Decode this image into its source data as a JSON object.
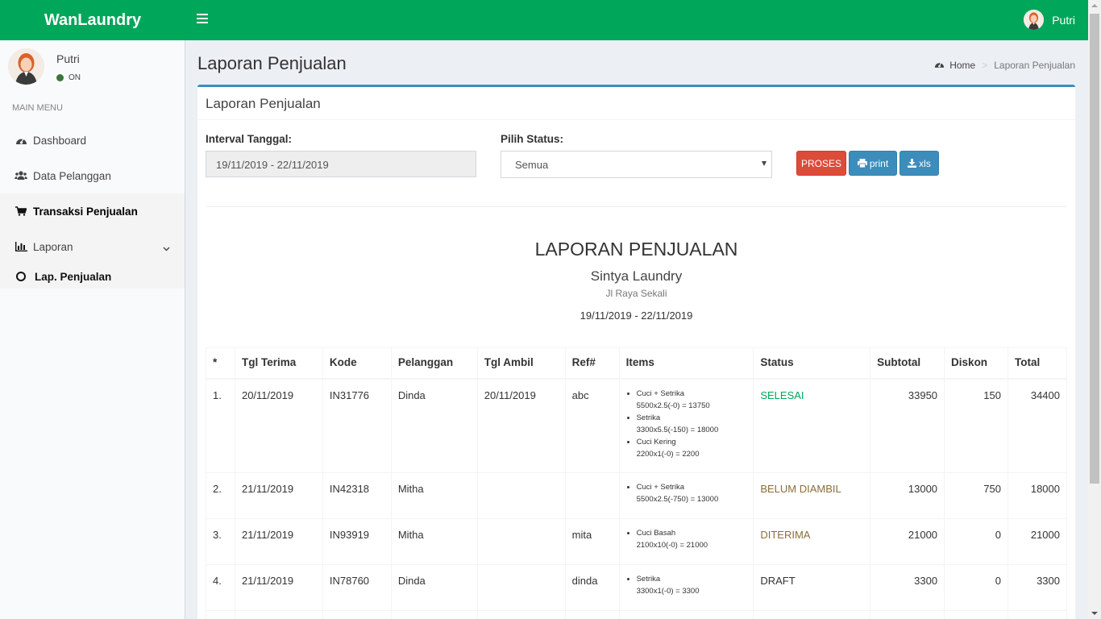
{
  "header": {
    "brand": "WanLaundry",
    "user_name": "Putri"
  },
  "sidebar": {
    "user_name": "Putri",
    "status": "ON",
    "menu_header": "MAIN MENU",
    "items": [
      {
        "label": "Dashboard",
        "icon": "dashboard-icon"
      },
      {
        "label": "Data Pelanggan",
        "icon": "users-icon"
      },
      {
        "label": "Transaksi Penjualan",
        "icon": "cart-icon"
      },
      {
        "label": "Laporan",
        "icon": "bar-chart-icon"
      }
    ],
    "subitem": "Lap. Penjualan"
  },
  "page": {
    "title": "Laporan Penjualan",
    "breadcrumb": {
      "home": "Home",
      "current": "Laporan Penjualan"
    }
  },
  "box": {
    "title": "Laporan Penjualan",
    "date_label": "Interval Tanggal:",
    "date_value": "19/11/2019 - 22/11/2019",
    "status_label": "Pilih Status:",
    "status_value": "Semua",
    "btn_proses": "PROSES",
    "btn_print": "print",
    "btn_xls": "xls"
  },
  "report": {
    "title": "LAPORAN PENJUALAN",
    "company": "Sintya Laundry",
    "address": "Jl Raya Sekali",
    "period": "19/11/2019 - 22/11/2019"
  },
  "table": {
    "columns": [
      "*",
      "Tgl Terima",
      "Kode",
      "Pelanggan",
      "Tgl Ambil",
      "Ref#",
      "Items",
      "Status",
      "Subtotal",
      "Diskon",
      "Total"
    ],
    "rows": [
      {
        "no": "1.",
        "tgl_terima": "20/11/2019",
        "kode": "IN31776",
        "pelanggan": "Dinda",
        "tgl_ambil": "20/11/2019",
        "ref": "abc",
        "items": [
          {
            "name": "Cuci + Setrika",
            "calc": "5500x2.5(-0) = 13750"
          },
          {
            "name": "Setrika",
            "calc": "3300x5.5(-150) = 18000"
          },
          {
            "name": "Cuci Kering",
            "calc": "2200x1(-0) = 2200"
          }
        ],
        "status": "SELESAI",
        "status_color": "#00a65a",
        "subtotal": "33950",
        "diskon": "150",
        "total": "34400"
      },
      {
        "no": "2.",
        "tgl_terima": "21/11/2019",
        "kode": "IN42318",
        "pelanggan": "Mitha",
        "tgl_ambil": "",
        "ref": "",
        "items": [
          {
            "name": "Cuci + Setrika",
            "calc": "5500x2.5(-750) = 13000"
          }
        ],
        "status": "BELUM DIAMBIL",
        "status_color": "#8a6d3b",
        "subtotal": "13000",
        "diskon": "750",
        "total": "18000"
      },
      {
        "no": "3.",
        "tgl_terima": "21/11/2019",
        "kode": "IN93919",
        "pelanggan": "Mitha",
        "tgl_ambil": "",
        "ref": "mita",
        "items": [
          {
            "name": "Cuci Basah",
            "calc": "2100x10(-0) = 21000"
          }
        ],
        "status": "DITERIMA",
        "status_color": "#8a6d3b",
        "subtotal": "21000",
        "diskon": "0",
        "total": "21000"
      },
      {
        "no": "4.",
        "tgl_terima": "21/11/2019",
        "kode": "IN78760",
        "pelanggan": "Dinda",
        "tgl_ambil": "",
        "ref": "dinda",
        "items": [
          {
            "name": "Setrika",
            "calc": "3300x1(-0) = 3300"
          }
        ],
        "status": "DRAFT",
        "status_color": "#333333",
        "subtotal": "3300",
        "diskon": "0",
        "total": "3300"
      }
    ]
  }
}
